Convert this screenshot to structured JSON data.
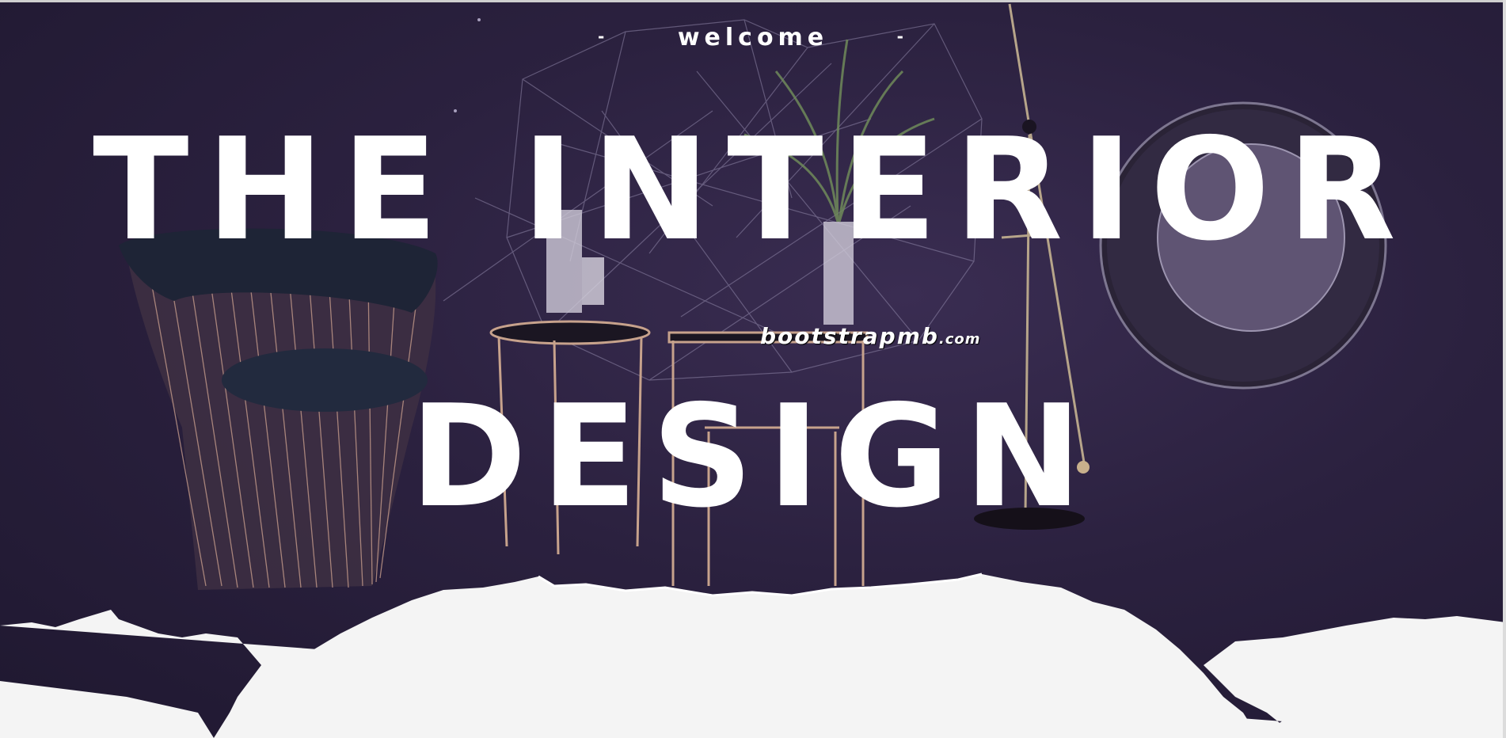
{
  "hero": {
    "welcome": "welcome",
    "dash_left": "-",
    "dash_right": "-",
    "title_line_1": "THE INTERIOR",
    "title_line_2": "DESIGN",
    "watermark_main": "bootstrapmb",
    "watermark_suffix": ".com"
  },
  "colors": {
    "background": "#2b213f",
    "text": "#ffffff",
    "torn_paper": "#f4f4f4"
  }
}
